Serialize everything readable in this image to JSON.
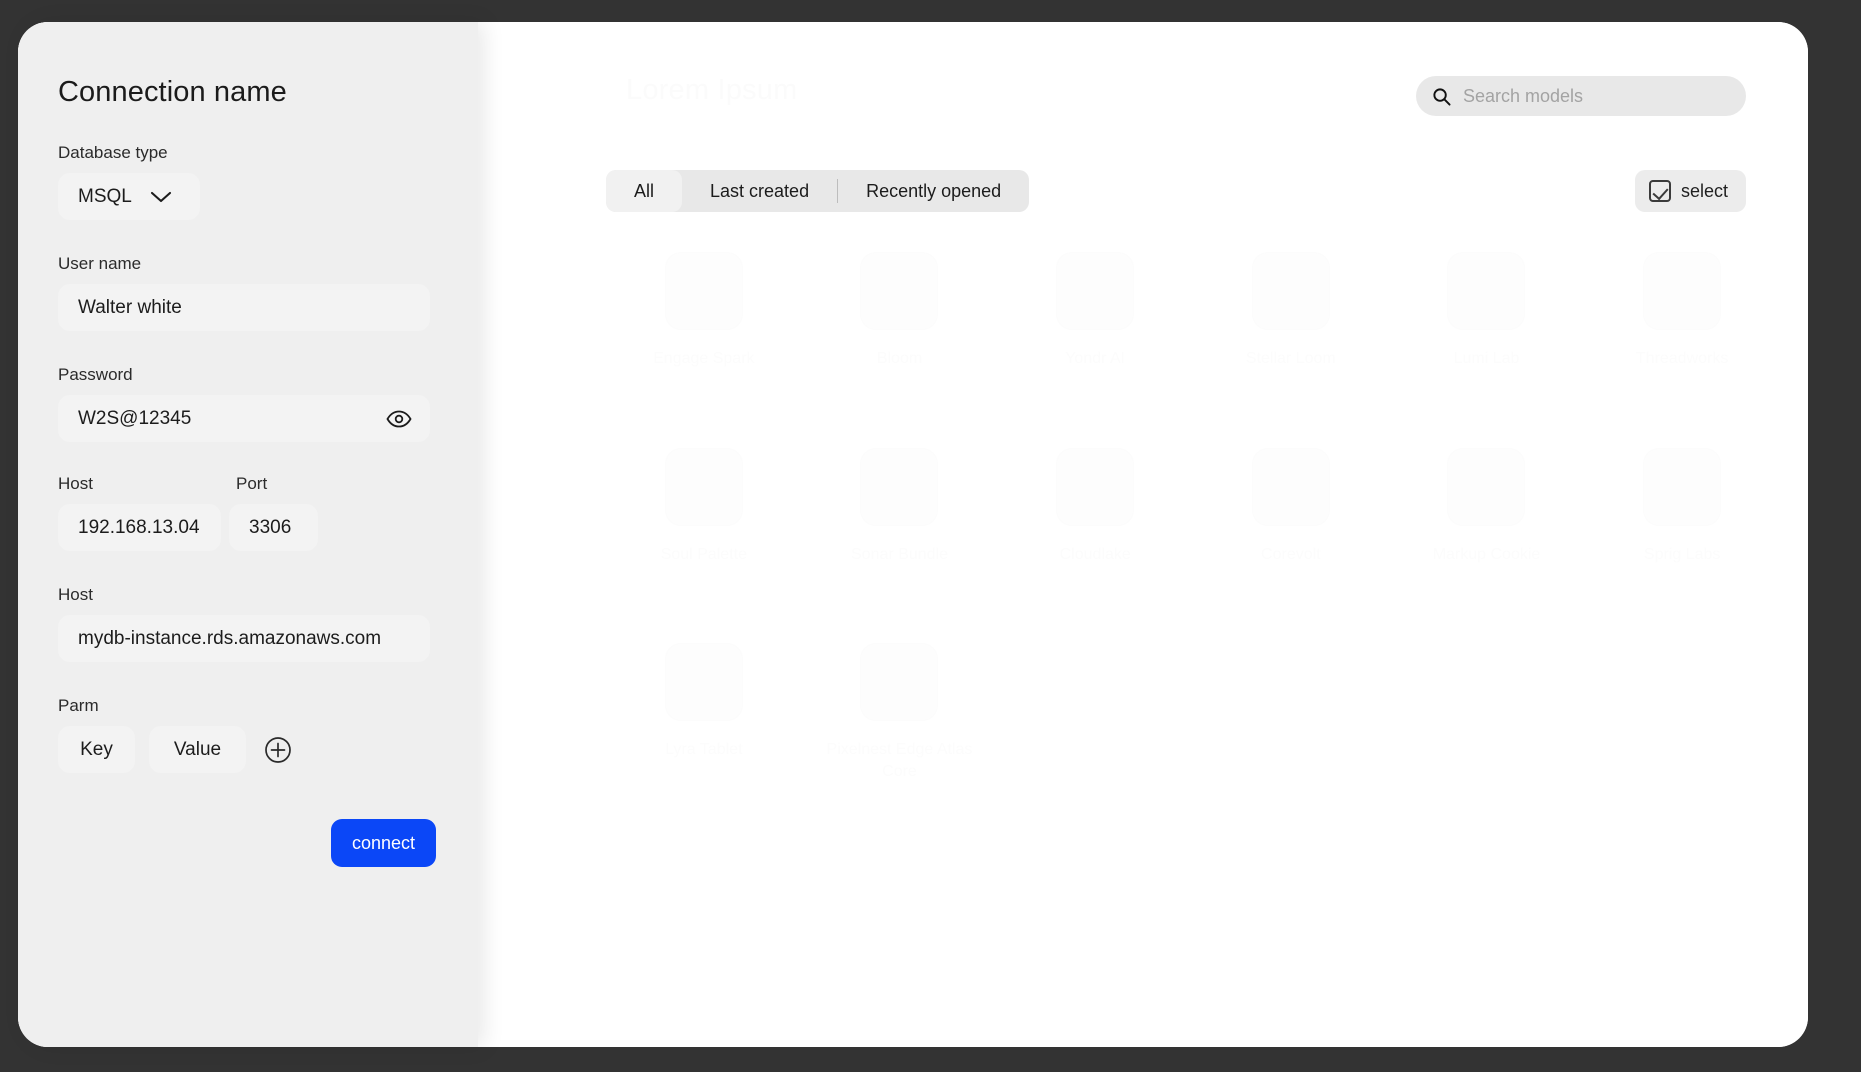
{
  "app": {
    "title": "Lorem Ipsum",
    "search": {
      "placeholder": "Search models",
      "icon": "search-icon"
    },
    "tabs": [
      {
        "label": "All",
        "active": true
      },
      {
        "label": "Last created",
        "active": false
      },
      {
        "label": "Recently opened",
        "active": false
      }
    ],
    "select_button": {
      "label": "select",
      "icon": "checkbox-checked-icon"
    },
    "models": [
      {
        "label": "Engage Spark"
      },
      {
        "label": "Bloom"
      },
      {
        "label": "Yondr AI"
      },
      {
        "label": "Stellar Loom"
      },
      {
        "label": "Lumi Lab"
      },
      {
        "label": "Threadworks"
      },
      {
        "label": "Soul Palette"
      },
      {
        "label": "Sonar Bundle"
      },
      {
        "label": "Cloudlake"
      },
      {
        "label": "Corevolt"
      },
      {
        "label": "Markup Cookie"
      },
      {
        "label": "Sprig Labs"
      },
      {
        "label": "Lyra Tablet"
      },
      {
        "label": "Pixelnest Edge Atlas Core"
      }
    ]
  },
  "panel": {
    "title": "Connection name",
    "database_type": {
      "label": "Database type",
      "value": "MSQL",
      "chevron_icon": "chevron-down-icon"
    },
    "username": {
      "label": "User name",
      "value": "Walter white"
    },
    "password": {
      "label": "Password",
      "value": "W2S@12345",
      "reveal_icon": "eye-icon"
    },
    "host": {
      "label": "Host",
      "value": "192.168.13.04"
    },
    "port": {
      "label": "Port",
      "value": "3306"
    },
    "host_endpoint": {
      "label": "Host",
      "value": "mydb-instance.rds.amazonaws.com"
    },
    "parm": {
      "label": "Parm",
      "key_placeholder": "Key",
      "value_placeholder": "Value",
      "add_icon": "plus-circle-icon"
    },
    "connect_button": {
      "label": "connect",
      "color": "#0b47f7"
    }
  },
  "colors": {
    "frame": "#333333",
    "panel_bg": "#efefef",
    "field_bg": "#f3f3f3",
    "accent": "#0b47f7",
    "chip_bg": "#e8e8e8"
  }
}
